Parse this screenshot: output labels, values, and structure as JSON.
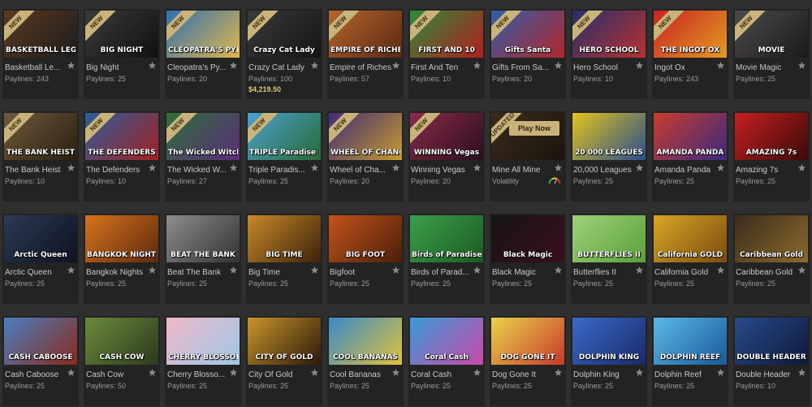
{
  "colors": {
    "page_bg": "#2f2f2f",
    "tile_bg": "#232323",
    "badge_gold": "#c9b37a",
    "jackpot_gold": "#d9c47c"
  },
  "icons": {
    "favorite": "star-icon",
    "volatility": "gauge-icon"
  },
  "tiles": [
    {
      "name": "Basketball Le...",
      "sub": "Paylines: 243",
      "badge": "NEW",
      "art": "BASKETBALL LEGENDS",
      "c1": "#5b3a22",
      "c2": "#1d1d1d"
    },
    {
      "name": "Big Night",
      "sub": "Paylines: 25",
      "badge": "NEW",
      "art": "BIG NIGHT",
      "c1": "#3a3a3a",
      "c2": "#111111"
    },
    {
      "name": "Cleopatra's Py...",
      "sub": "Paylines: 20",
      "badge": "NEW",
      "art": "CLEOPATRA'S PYRAMID II",
      "c1": "#2f6fb0",
      "c2": "#e0b64b"
    },
    {
      "name": "Crazy Cat Lady",
      "sub": "Paylines: 100",
      "badge": "NEW",
      "art": "Crazy Cat Lady",
      "c1": "#3a3a3a",
      "c2": "#151515",
      "jackpot": "$4,219.50"
    },
    {
      "name": "Empire of Riches",
      "sub": "Paylines: 57",
      "badge": "NEW",
      "art": "EMPIRE OF RICHES",
      "c1": "#b5662a",
      "c2": "#5a2814"
    },
    {
      "name": "First And Ten",
      "sub": "Paylines: 10",
      "badge": "NEW",
      "art": "FIRST AND 10",
      "c1": "#2d8a3b",
      "c2": "#b21d1d"
    },
    {
      "name": "Gifts From Sa...",
      "sub": "Paylines: 20",
      "badge": "NEW",
      "art": "Gifts Santa",
      "c1": "#2f5ea8",
      "c2": "#b3262a"
    },
    {
      "name": "Hero School",
      "sub": "Paylines: 10",
      "badge": "NEW",
      "art": "HERO SCHOOL",
      "c1": "#24306a",
      "c2": "#b83131"
    },
    {
      "name": "Ingot Ox",
      "sub": "Paylines: 243",
      "badge": "NEW",
      "art": "THE INGOT OX",
      "c1": "#c82323",
      "c2": "#e39a22"
    },
    {
      "name": "Movie Magic",
      "sub": "Paylines: 25",
      "badge": "NEW",
      "art": "MOVIE",
      "c1": "#4b4b4b",
      "c2": "#1b1b1b"
    },
    {
      "name": "The Bank Heist",
      "sub": "Paylines: 10",
      "badge": "NEW",
      "art": "THE BANK HEIST",
      "c1": "#6e5a3a",
      "c2": "#2a1f12"
    },
    {
      "name": "The Defenders",
      "sub": "Paylines: 10",
      "badge": "NEW",
      "art": "THE DEFENDERS",
      "c1": "#2b5d9c",
      "c2": "#a32121"
    },
    {
      "name": "The Wicked W...",
      "sub": "Paylines: 27",
      "badge": "NEW",
      "art": "The Wicked Witches",
      "c1": "#2f6e3a",
      "c2": "#5c2d7a"
    },
    {
      "name": "Triple Paradis...",
      "sub": "Paylines: 25",
      "badge": "NEW",
      "art": "TRIPLE Paradise Riches",
      "c1": "#49a1cf",
      "c2": "#2a6a35"
    },
    {
      "name": "Wheel of Cha...",
      "sub": "Paylines: 20",
      "badge": "NEW",
      "art": "WHEEL OF CHANCE II",
      "c1": "#3f2c78",
      "c2": "#c79a2c"
    },
    {
      "name": "Winning Vegas",
      "sub": "Paylines: 20",
      "badge": "NEW",
      "art": "WINNING Vegas",
      "c1": "#8a2a4c",
      "c2": "#2a0f1c"
    },
    {
      "name": "Mine All Mine",
      "sub": "Volatility",
      "badge": "UPDATED",
      "art": "",
      "c1": "#3a2c1c",
      "c2": "#1b140c",
      "playnow": "Play Now",
      "gauge": true
    },
    {
      "name": "20,000 Leagues",
      "sub": "Paylines: 25",
      "badge": "",
      "art": "20 000 LEAGUES",
      "c1": "#e2c21d",
      "c2": "#2a4f8c"
    },
    {
      "name": "Amanda Panda",
      "sub": "Paylines: 25",
      "badge": "",
      "art": "AMANDA PANDA",
      "c1": "#c93c2a",
      "c2": "#3b2a80"
    },
    {
      "name": "Amazing 7s",
      "sub": "Paylines: 25",
      "badge": "",
      "art": "AMAZING 7s",
      "c1": "#c61f1f",
      "c2": "#3a0a0a"
    },
    {
      "name": "Arctic Queen",
      "sub": "Paylines: 25",
      "badge": "",
      "art": "Arctic Queen",
      "c1": "#2c3a55",
      "c2": "#0d1220"
    },
    {
      "name": "Bangkok Nights",
      "sub": "Paylines: 25",
      "badge": "",
      "art": "BANGKOK NIGHTS",
      "c1": "#d8731c",
      "c2": "#5c2a0c"
    },
    {
      "name": "Beat The Bank",
      "sub": "Paylines: 25",
      "badge": "",
      "art": "BEAT THE BANK",
      "c1": "#8d8d8d",
      "c2": "#333333"
    },
    {
      "name": "Big Time",
      "sub": "Paylines: 25",
      "badge": "",
      "art": "BIG TIME",
      "c1": "#c88a2a",
      "c2": "#3c220a"
    },
    {
      "name": "Bigfoot",
      "sub": "Paylines: 25",
      "badge": "",
      "art": "BIG FOOT",
      "c1": "#c4541c",
      "c2": "#4a1e0a"
    },
    {
      "name": "Birds of Parad...",
      "sub": "Paylines: 25",
      "badge": "",
      "art": "Birds of Paradise",
      "c1": "#3aa04a",
      "c2": "#1d5a23"
    },
    {
      "name": "Black Magic",
      "sub": "Paylines: 25",
      "badge": "",
      "art": "Black Magic",
      "c1": "#151515",
      "c2": "#3a0d1d"
    },
    {
      "name": "Butterflies II",
      "sub": "Paylines: 25",
      "badge": "",
      "art": "BUTTERFLIES II",
      "c1": "#9ed17a",
      "c2": "#5aa03a"
    },
    {
      "name": "California Gold",
      "sub": "Paylines: 25",
      "badge": "",
      "art": "California GOLD",
      "c1": "#d8a524",
      "c2": "#7a4d0e"
    },
    {
      "name": "Caribbean Gold",
      "sub": "Paylines: 25",
      "badge": "",
      "art": "Caribbean Gold",
      "c1": "#3a2c1c",
      "c2": "#8c6a2c"
    },
    {
      "name": "Cash Caboose",
      "sub": "Paylines: 25",
      "badge": "",
      "art": "CASH CABOOSE",
      "c1": "#4a7fc0",
      "c2": "#8a2a1c"
    },
    {
      "name": "Cash Cow",
      "sub": "Paylines: 50",
      "badge": "",
      "art": "CASH COW",
      "c1": "#6a8a3c",
      "c2": "#2c3a1c"
    },
    {
      "name": "Cherry Blosso...",
      "sub": "Paylines: 25",
      "badge": "",
      "art": "CHERRY BLOSSOMS",
      "c1": "#f0b8c8",
      "c2": "#9ec8e8"
    },
    {
      "name": "City Of Gold",
      "sub": "Paylines: 25",
      "badge": "",
      "art": "CITY OF GOLD",
      "c1": "#c8952a",
      "c2": "#2c1a0a"
    },
    {
      "name": "Cool Bananas",
      "sub": "Paylines: 25",
      "badge": "",
      "art": "COOL BANANAS",
      "c1": "#3a8ac8",
      "c2": "#e0c23a"
    },
    {
      "name": "Coral Cash",
      "sub": "Paylines: 25",
      "badge": "",
      "art": "Coral Cash",
      "c1": "#3a9ad8",
      "c2": "#c84aa8"
    },
    {
      "name": "Dog Gone It",
      "sub": "Paylines: 25",
      "badge": "",
      "art": "DOG GONE IT",
      "c1": "#e8d24a",
      "c2": "#c83a2a"
    },
    {
      "name": "Dolphin King",
      "sub": "Paylines: 25",
      "badge": "",
      "art": "DOLPHIN KING",
      "c1": "#3a6ac8",
      "c2": "#1a2a6a"
    },
    {
      "name": "Dolphin Reef",
      "sub": "Paylines: 25",
      "badge": "",
      "art": "DOLPHIN REEF",
      "c1": "#5ab8e8",
      "c2": "#1a5a9a"
    },
    {
      "name": "Double Header",
      "sub": "Paylines: 10",
      "badge": "",
      "art": "DOUBLE HEADER",
      "c1": "#2a4a8a",
      "c2": "#0d1a3a"
    }
  ]
}
